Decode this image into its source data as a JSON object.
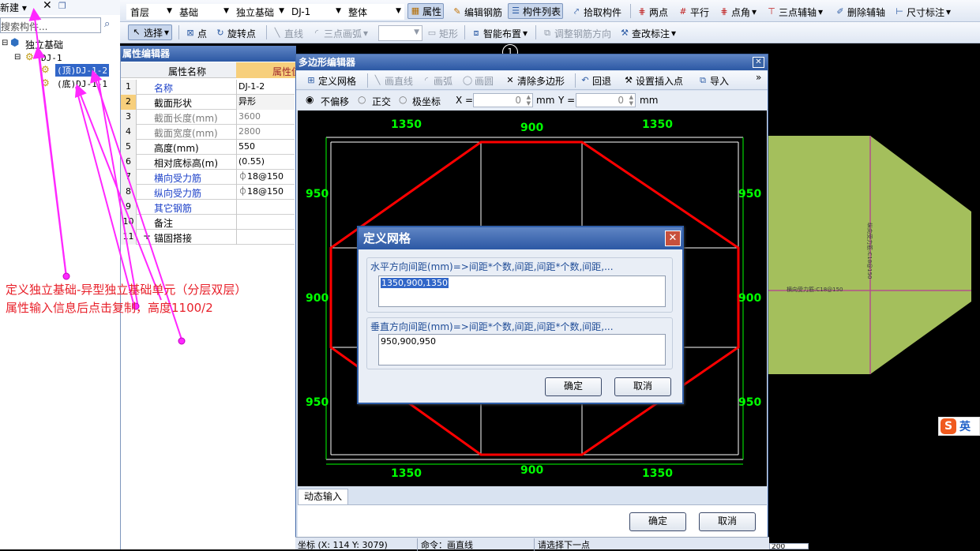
{
  "main_toolbar": {
    "row1": {
      "floor": "首层",
      "category": "基础",
      "type": "独立基础",
      "item": "DJ-1",
      "scope": "整体",
      "attributes": "属性",
      "edit_rebar": "编辑钢筋",
      "component_list": "构件列表",
      "pick": "拾取构件",
      "two_points": "两点",
      "parallel": "平行",
      "point_angle": "点角",
      "three_point_axis": "三点辅轴",
      "delete_axis": "删除辅轴",
      "dimension": "尺寸标注"
    },
    "row2": {
      "select": "选择",
      "point": "点",
      "rotate_point": "旋转点",
      "line": "直线",
      "three_point_arc": "三点画弧",
      "rectangle": "矩形",
      "smart_layout": "智能布置",
      "adjust_rebar": "调整钢筋方向",
      "check_label": "查改标注"
    }
  },
  "left_panel": {
    "new_label": "新建",
    "search_placeholder": "搜索构件...",
    "tree": {
      "root": "独立基础",
      "dj1": "DJ-1",
      "top": "(顶)DJ-1-2",
      "bottom": "(底)DJ-1-1"
    }
  },
  "annotation": {
    "line1": "定义独立基础-异型独立基础单元（分层双层）",
    "line2": "属性输入信息后点击复制，高度1100/2"
  },
  "prop_editor": {
    "title": "属性编辑器",
    "col_name": "属性名称",
    "col_value": "属性值",
    "rows": [
      {
        "n": "1",
        "k": "名称",
        "v": "DJ-1-2",
        "blue": true,
        "gray": false
      },
      {
        "n": "2",
        "k": "截面形状",
        "v": "异形",
        "blue": false,
        "gray": false
      },
      {
        "n": "3",
        "k": "截面长度(mm)",
        "v": "3600",
        "blue": false,
        "gray": true
      },
      {
        "n": "4",
        "k": "截面宽度(mm)",
        "v": "2800",
        "blue": false,
        "gray": true
      },
      {
        "n": "5",
        "k": "高度(mm)",
        "v": "550",
        "blue": false,
        "gray": false
      },
      {
        "n": "6",
        "k": "相对底标高(m)",
        "v": "(0.55)",
        "blue": false,
        "gray": false
      },
      {
        "n": "7",
        "k": "横向受力筋",
        "v": "⏀18@150",
        "blue": true,
        "gray": false
      },
      {
        "n": "8",
        "k": "纵向受力筋",
        "v": "⏀18@150",
        "blue": true,
        "gray": false
      },
      {
        "n": "9",
        "k": "其它钢筋",
        "v": "",
        "blue": true,
        "gray": false
      },
      {
        "n": "10",
        "k": "备注",
        "v": "",
        "blue": false,
        "gray": false
      },
      {
        "n": "11",
        "k": "锚固搭接",
        "v": "",
        "blue": false,
        "gray": false
      }
    ]
  },
  "poly_editor": {
    "title": "多边形编辑器",
    "define_grid": "定义网格",
    "line": "画直线",
    "arc": "画弧",
    "circle": "画圆",
    "clear_polygon": "清除多边形",
    "undo": "回退",
    "set_insert_point": "设置插入点",
    "import": "导入",
    "no_offset": "不偏移",
    "orthogonal": "正交",
    "polar": "极坐标",
    "x_label": "X =",
    "x_value": "0",
    "y_label": "Y =",
    "y_value": "0",
    "mm": "mm",
    "dynamic_input": "动态输入",
    "ok": "确定",
    "cancel": "取消",
    "dims_top": [
      "1350",
      "900",
      "1350"
    ],
    "dims_bottom": [
      "1350",
      "900",
      "1350"
    ],
    "dims_left": [
      "950",
      "900",
      "950"
    ],
    "dims_right": [
      "950",
      "900",
      "950"
    ]
  },
  "grid_dialog": {
    "title": "定义网格",
    "h_label": "水平方向间距(mm)=>间距*个数,间距,间距*个数,间距,...",
    "h_value": "1350,900,1350",
    "v_label": "垂直方向间距(mm)=>间距*个数,间距,间距*个数,间距,...",
    "v_value": "950,900,950",
    "ok": "确定",
    "cancel": "取消"
  },
  "canvas_labels": {
    "axis_marker": "1",
    "shape_label_h": "横向受力筋:C18@150",
    "shape_label_v": "纵向受力筋:C18@150"
  },
  "status": {
    "coord": "坐标 (X: 114 Y: 3079)",
    "command": "命令：画直线",
    "prompt": "请选择下一点",
    "zoom": "200"
  },
  "ime": {
    "logo": "S",
    "lang": "英"
  },
  "colors": {
    "grid_green": "#00ff00",
    "polygon_red": "#ff0000",
    "shape_fill": "#a4bf5c",
    "annotation": "#e8202a",
    "arrow": "#ff28ff"
  }
}
